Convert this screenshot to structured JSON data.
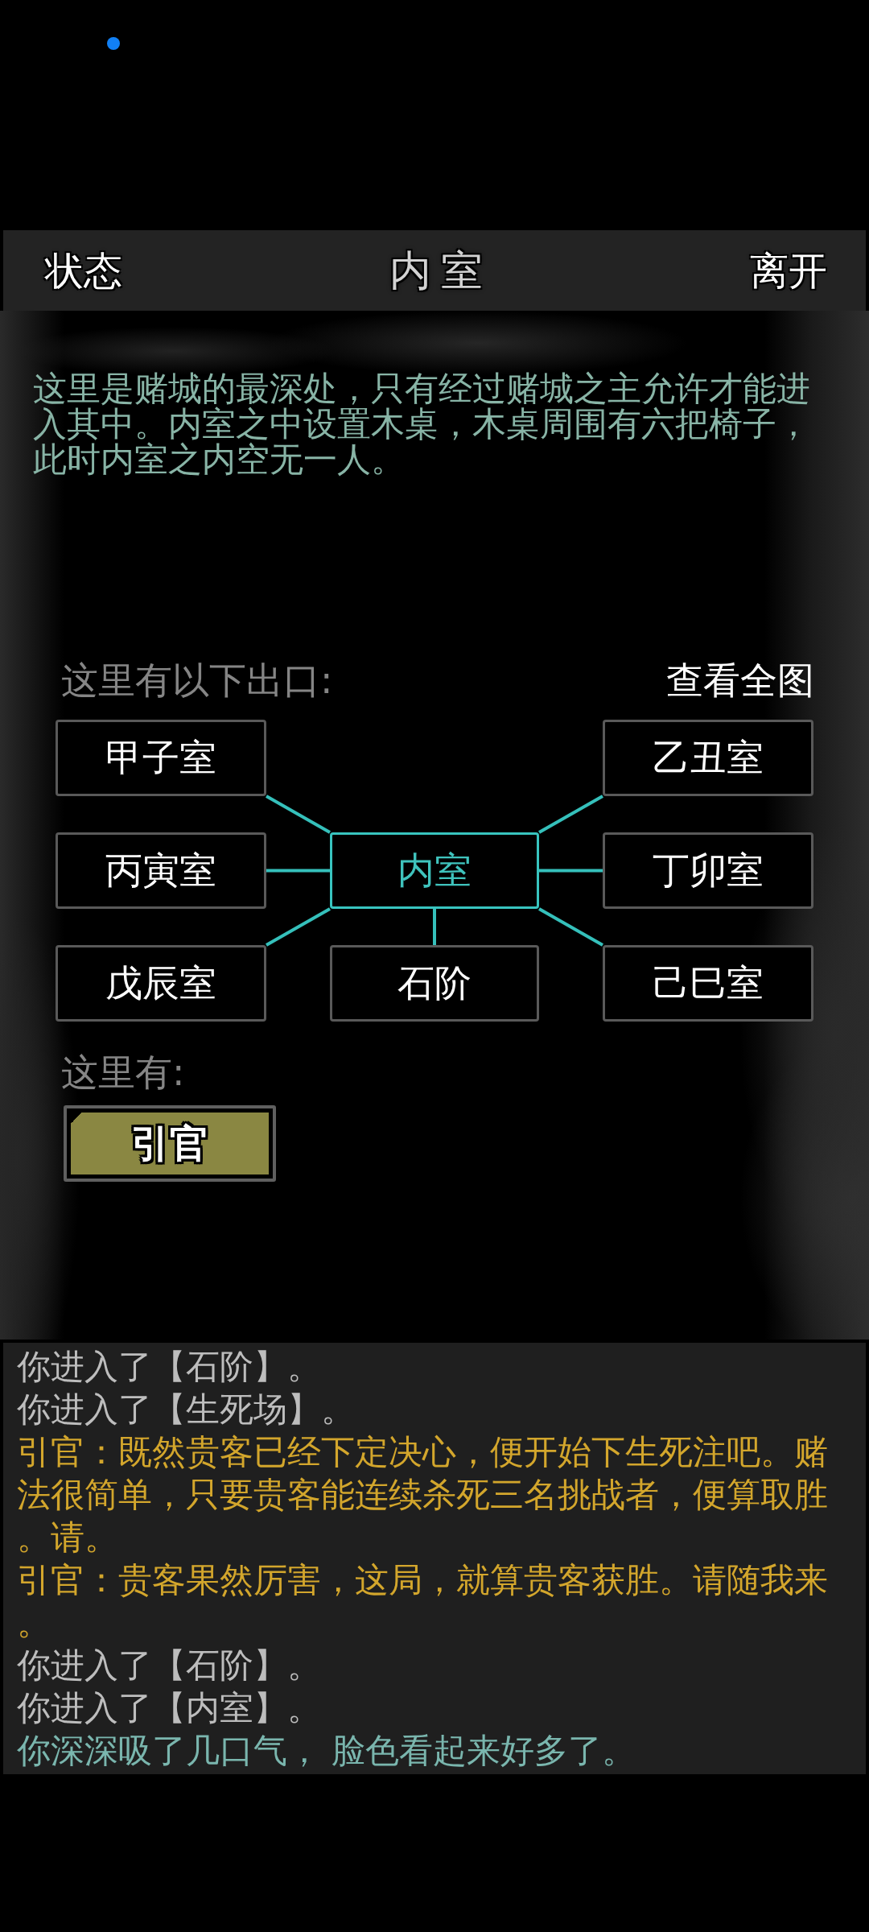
{
  "header": {
    "left_button": "状态",
    "title": "内室",
    "right_button": "离开"
  },
  "room": {
    "description": "这里是赌城的最深处，只有经过赌城之主允许才能进入其中。内室之中设置木桌，木桌周围有六把椅子，此时内室之内空无一人。"
  },
  "exits": {
    "heading": "这里有以下出口:",
    "map_button": "查看全图",
    "rows": [
      {
        "left": {
          "label": "甲子室",
          "current": false
        },
        "right": {
          "label": "乙丑室",
          "current": false
        }
      },
      {
        "left": {
          "label": "丙寅室",
          "current": false
        },
        "middle": {
          "label": "内室",
          "current": true
        },
        "right": {
          "label": "丁卯室",
          "current": false
        }
      },
      {
        "left": {
          "label": "戊辰室",
          "current": false
        },
        "middle": {
          "label": "石阶",
          "current": false
        },
        "right": {
          "label": "己巳室",
          "current": false
        }
      }
    ]
  },
  "people": {
    "heading": "这里有:",
    "npcs": [
      {
        "name": "引官"
      }
    ]
  },
  "log": [
    {
      "kind": "system",
      "text": "你进入了【石阶】。"
    },
    {
      "kind": "system",
      "text": "你进入了【生死场】。"
    },
    {
      "kind": "npc",
      "text": "引官：既然贵客已经下定决心，便开始下生死注吧。赌法很简单，只要贵客能连续杀死三名挑战者，便算取胜。请。"
    },
    {
      "kind": "npc",
      "text": "引官：贵客果然厉害，这局，就算贵客获胜。请随我来。"
    },
    {
      "kind": "system",
      "text": "你进入了【石阶】。"
    },
    {
      "kind": "system",
      "text": "你进入了【内室】。"
    },
    {
      "kind": "status",
      "text": "你深深吸了几口气， 脸色看起来好多了。"
    }
  ]
}
